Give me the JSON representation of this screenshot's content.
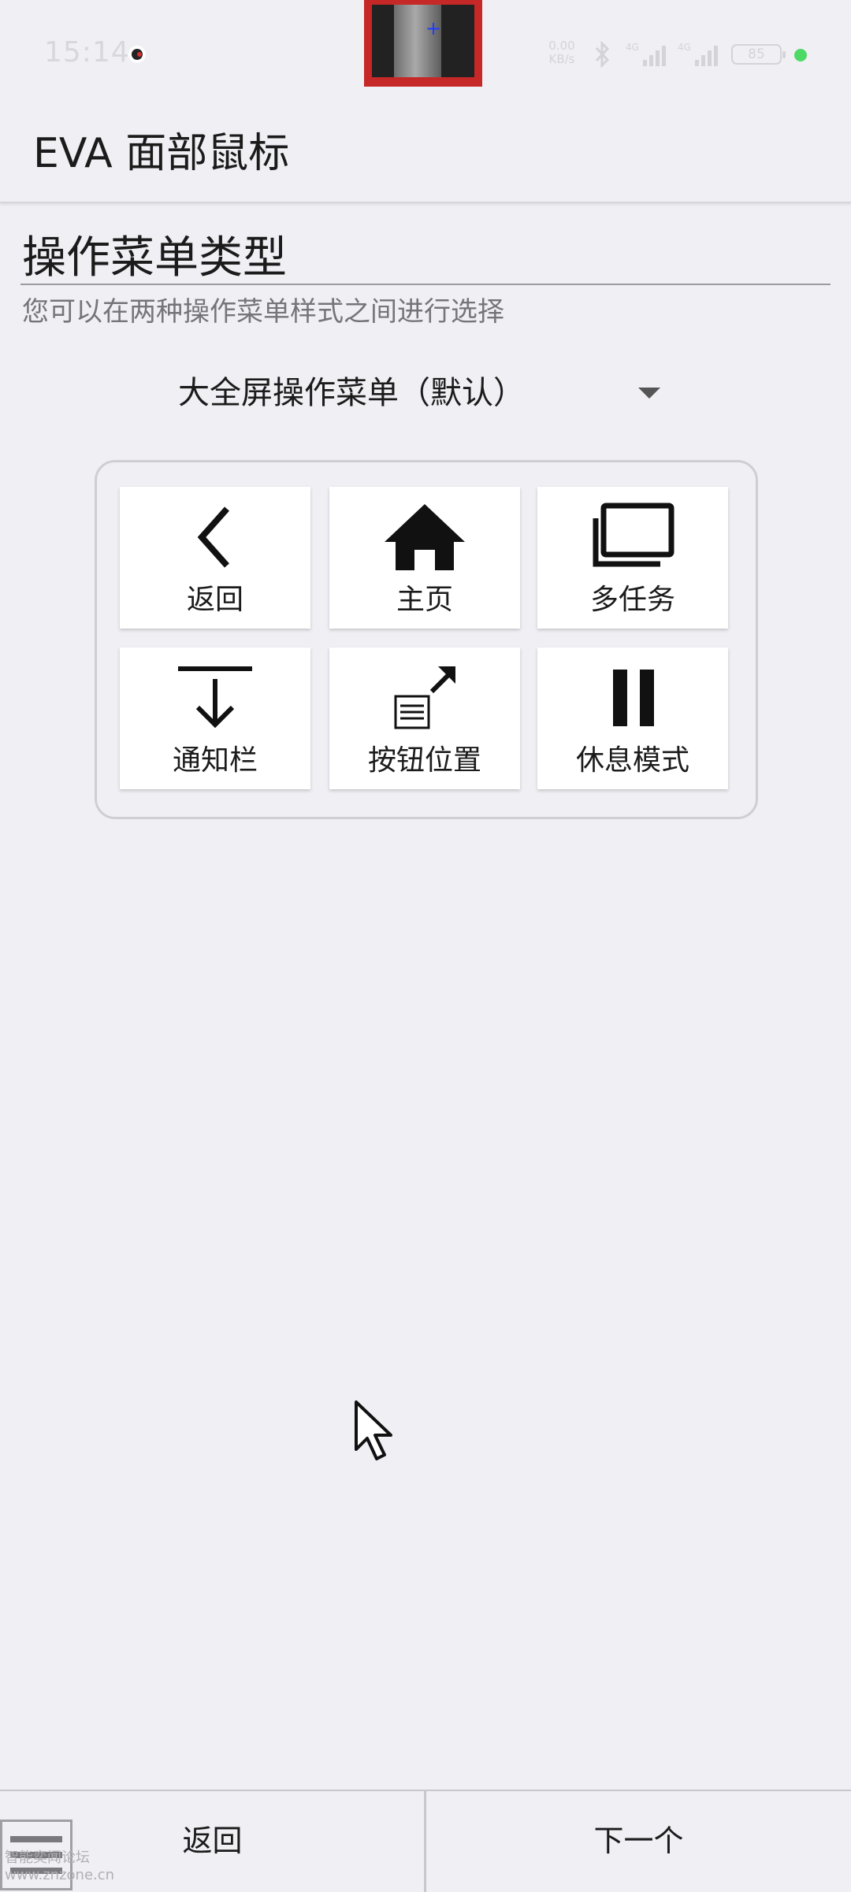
{
  "status_bar": {
    "time": "15:14",
    "speed": "0.00\nKB/s",
    "network1": "4G",
    "network2": "4G",
    "battery": "85"
  },
  "app_bar": {
    "title": "EVA 面部鼠标"
  },
  "preference": {
    "title": "操作菜单类型",
    "summary": "您可以在两种操作菜单样式之间进行选择",
    "selected_option": "大全屏操作菜单（默认）"
  },
  "menu_buttons": [
    {
      "label": "返回",
      "icon": "back-arrow-icon"
    },
    {
      "label": "主页",
      "icon": "home-icon"
    },
    {
      "label": "多任务",
      "icon": "recents-icon"
    },
    {
      "label": "通知栏",
      "icon": "notification-pull-icon"
    },
    {
      "label": "按钮位置",
      "icon": "button-position-icon"
    },
    {
      "label": "休息模式",
      "icon": "pause-icon"
    }
  ],
  "bottom_nav": {
    "back_label": "返回",
    "next_label": "下一个"
  },
  "watermark": {
    "line1": "智能奕闻论坛",
    "line2": "www.znzone.cn"
  }
}
